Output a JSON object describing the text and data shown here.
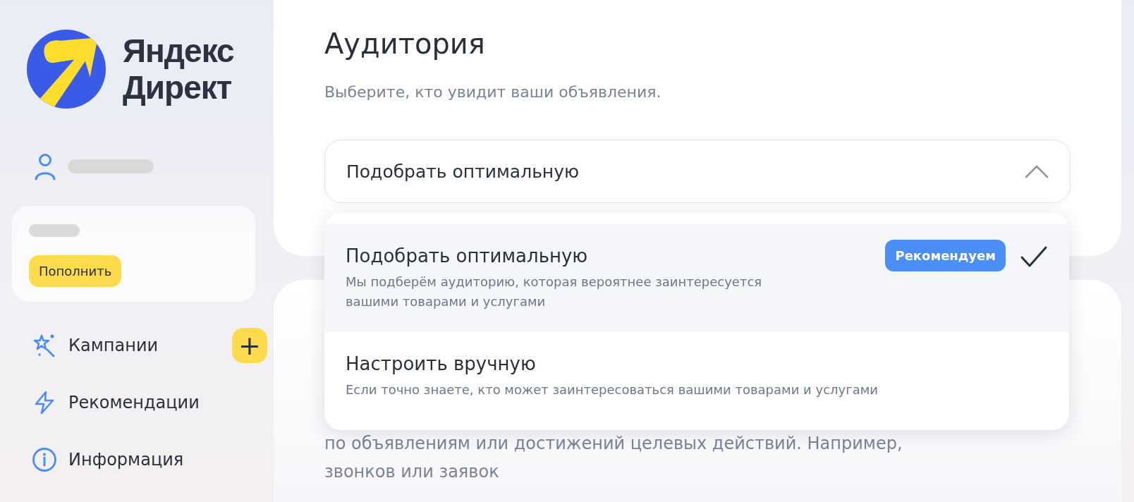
{
  "logo": {
    "line_1": "Яндекс",
    "line_2": "Директ"
  },
  "balance": {
    "button": "Пополнить"
  },
  "nav": [
    {
      "label": "Кампании",
      "add_button": "+"
    },
    {
      "label": "Рекомендации"
    },
    {
      "label": "Информация"
    }
  ],
  "audience": {
    "title": "Аудитория",
    "subtitle": "Выберите, кто увидит ваши объявления.",
    "select_value": "Подобрать оптимальную",
    "expanded": true
  },
  "options": [
    {
      "title": "Подобрать оптимальную",
      "description": "Мы подберём аудиторию, которая вероятнее заинтересуется вашими товарами и услугами",
      "badge": "Рекомендуем",
      "selected": true
    },
    {
      "title": "Настроить вручную",
      "description": "Если точно знаете, кто может заинтересоваться вашими товарами и услугами",
      "selected": false
    }
  ],
  "next_card": {
    "lines": [
      "по объявлениям или достижений целевых действий. Например,",
      "звонков или заявок"
    ]
  }
}
